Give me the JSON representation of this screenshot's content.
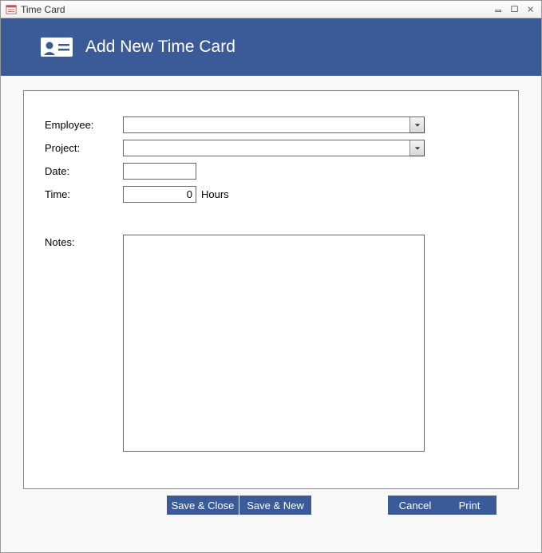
{
  "window": {
    "title": "Time Card"
  },
  "banner": {
    "title": "Add New Time Card"
  },
  "form": {
    "employee_label": "Employee:",
    "employee_value": "",
    "project_label": "Project:",
    "project_value": "",
    "date_label": "Date:",
    "date_value": "",
    "time_label": "Time:",
    "time_value": "0",
    "time_unit": "Hours",
    "notes_label": "Notes:",
    "notes_value": ""
  },
  "buttons": {
    "save_close": "Save & Close",
    "save_new": "Save & New",
    "cancel": "Cancel",
    "print": "Print"
  }
}
